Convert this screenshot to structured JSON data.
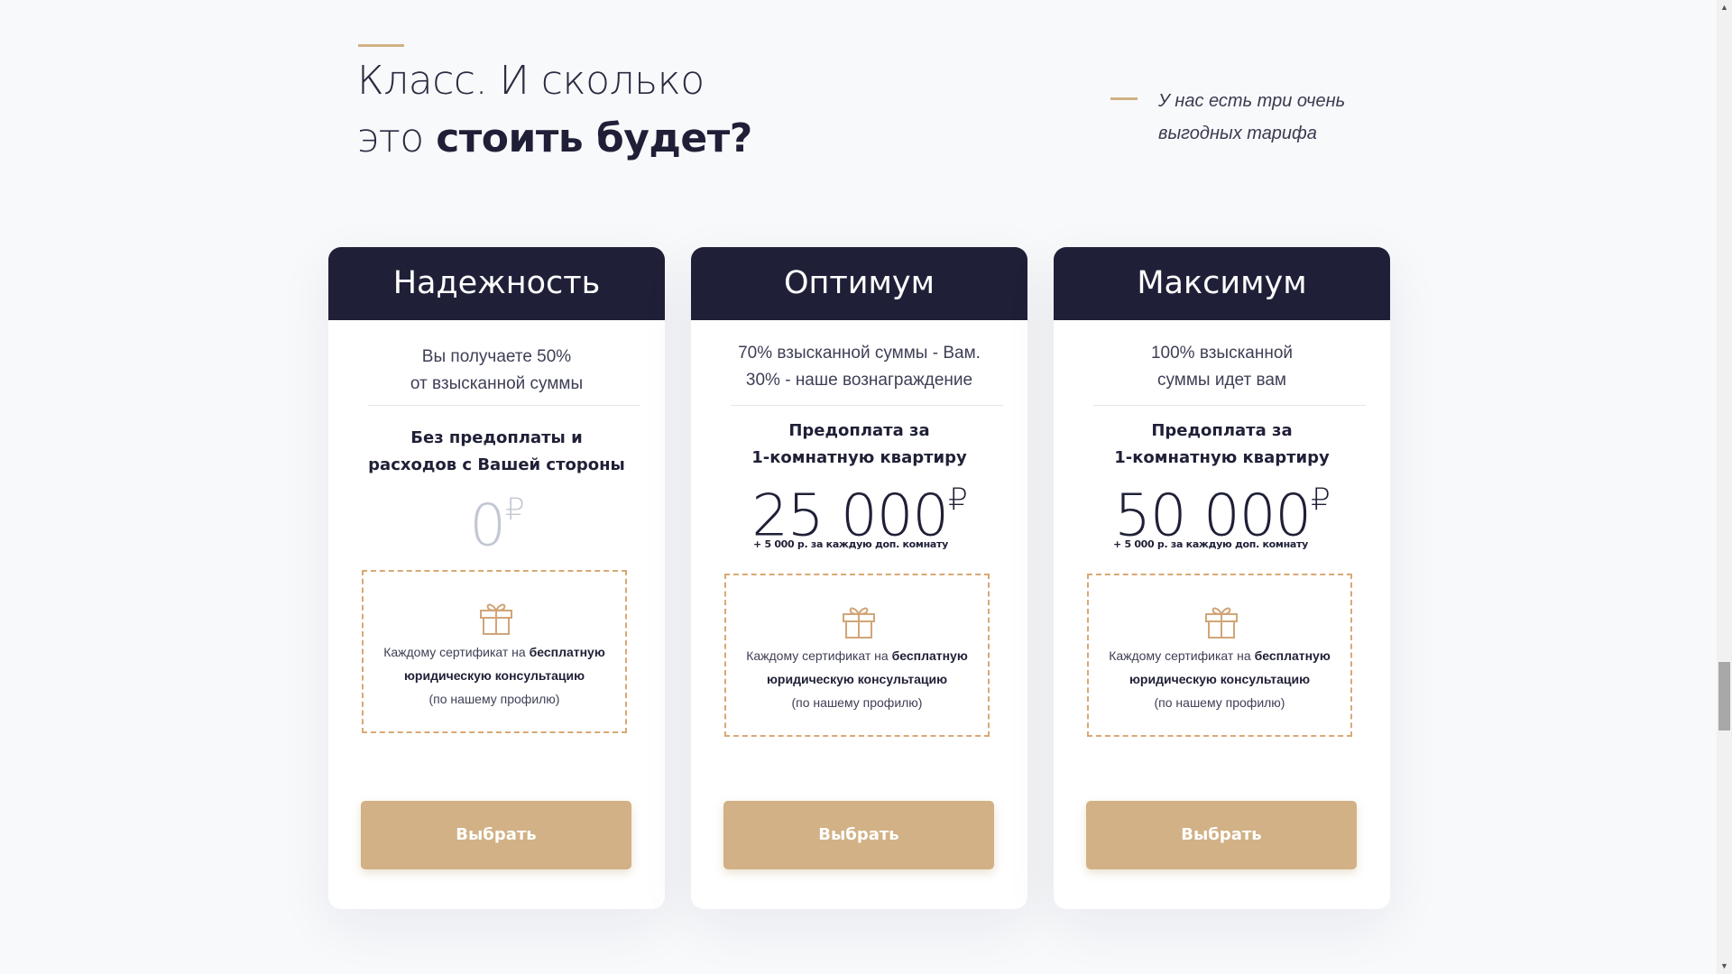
{
  "section": {
    "heading_line1": "Класс. И сколько",
    "heading_line2_light": "это ",
    "heading_line2_bold": "стоить будет?",
    "subtitle_line1": "У нас есть три очень",
    "subtitle_line2": "выгодных тарифа"
  },
  "cards": [
    {
      "title": "Надежность",
      "desc_line1": "Вы получаете 50%",
      "desc_line2": "от взысканной суммы",
      "terms_line1": "Без предоплаты и",
      "terms_line2": "расходов с Вашей стороны",
      "price": "0",
      "currency": "₽",
      "extra": "",
      "gift_text_plain": "Каждому сертификат на ",
      "gift_text_bold1": "бесплатную",
      "gift_text_bold2": "юридическую консультацию",
      "gift_text_note": "(по нашему профилю)",
      "button": "Выбрать"
    },
    {
      "title": "Оптимум",
      "desc_line1": "70% взысканной суммы - Вам.",
      "desc_line2": "30% - наше вознаграждение",
      "terms_line1": "Предоплата за",
      "terms_line2": "1-комнатную квартиру",
      "price": "25 000",
      "currency": "₽",
      "extra": "+ 5 000 р. за каждую доп. комнату",
      "gift_text_plain": "Каждому сертификат на ",
      "gift_text_bold1": "бесплатную",
      "gift_text_bold2": "юридическую консультацию",
      "gift_text_note": "(по нашему профилю)",
      "button": "Выбрать"
    },
    {
      "title": "Максимум",
      "desc_line1": "100% взысканной",
      "desc_line2": "суммы идет вам",
      "terms_line1": "Предоплата за",
      "terms_line2": "1-комнатную квартиру",
      "price": "50 000",
      "currency": "₽",
      "extra": "+ 5 000 р. за каждую доп. комнату",
      "gift_text_plain": "Каждому сертификат на ",
      "gift_text_bold1": "бесплатную",
      "gift_text_bold2": "юридическую консультацию",
      "gift_text_note": "(по нашему профилю)",
      "button": "Выбрать"
    }
  ],
  "colors": {
    "accent": "#d1b185",
    "dark": "#1f2038",
    "gift_border": "#d9a875",
    "zero_price": "#c3c7d3"
  },
  "icons": [
    "gift-icon"
  ]
}
